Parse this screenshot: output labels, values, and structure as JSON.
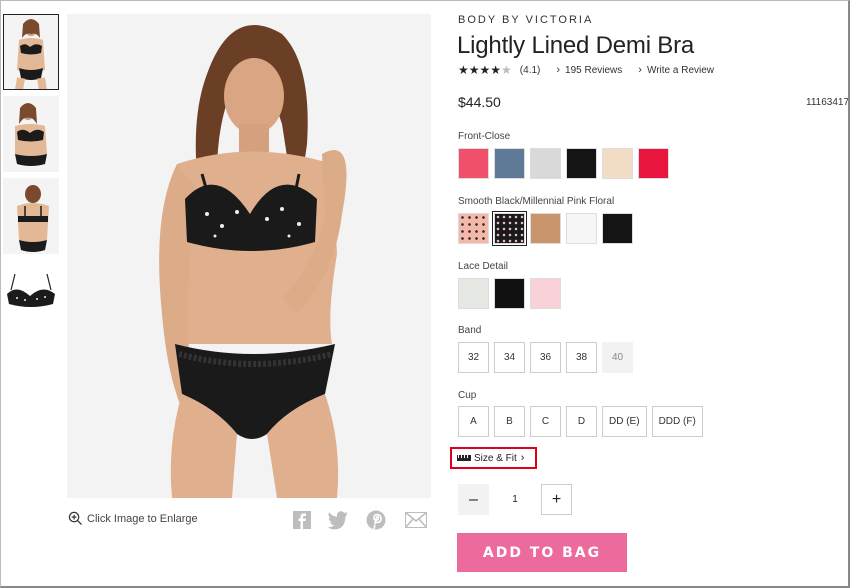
{
  "product": {
    "brand": "BODY BY VICTORIA",
    "title": "Lightly Lined Demi Bra",
    "rating_display": "(4.1)",
    "rating_value": 4.1,
    "reviews_label": "195 Reviews",
    "write_review_label": "Write a Review",
    "price": "$44.50",
    "sku": "11163417"
  },
  "image": {
    "enlarge_label": "Click Image to Enlarge"
  },
  "share_icons": [
    "facebook-icon",
    "twitter-icon",
    "pinterest-icon",
    "email-icon"
  ],
  "color_groups": [
    {
      "label": "Front-Close",
      "swatches": [
        "#f0506a",
        "#5e7a96",
        "#d9d9d9",
        "#141414",
        "#f3dcc6",
        "#e8163e"
      ]
    },
    {
      "label": "Smooth Black/Millennial Pink Floral",
      "swatches": [
        "#f5b8a8",
        "#1a1a1a",
        "#c8956d",
        "#f6f6f6",
        "#141414"
      ],
      "selected_index": 1
    },
    {
      "label": "Lace Detail",
      "swatches": [
        "#e5e8e3",
        "#111111",
        "#f8d2d8"
      ]
    }
  ],
  "band": {
    "label": "Band",
    "options": [
      "32",
      "34",
      "36",
      "38",
      "40"
    ],
    "disabled": [
      "40"
    ]
  },
  "cup": {
    "label": "Cup",
    "options": [
      "A",
      "B",
      "C",
      "D",
      "DD (E)",
      "DDD (F)"
    ]
  },
  "size_fit_label": "Size & Fit",
  "quantity": {
    "minus": "–",
    "value": "1",
    "plus": "+"
  },
  "add_to_bag_label": "ADD TO BAG",
  "colors": {
    "accent": "#ec6a9c",
    "highlight_border": "#e0001b"
  }
}
